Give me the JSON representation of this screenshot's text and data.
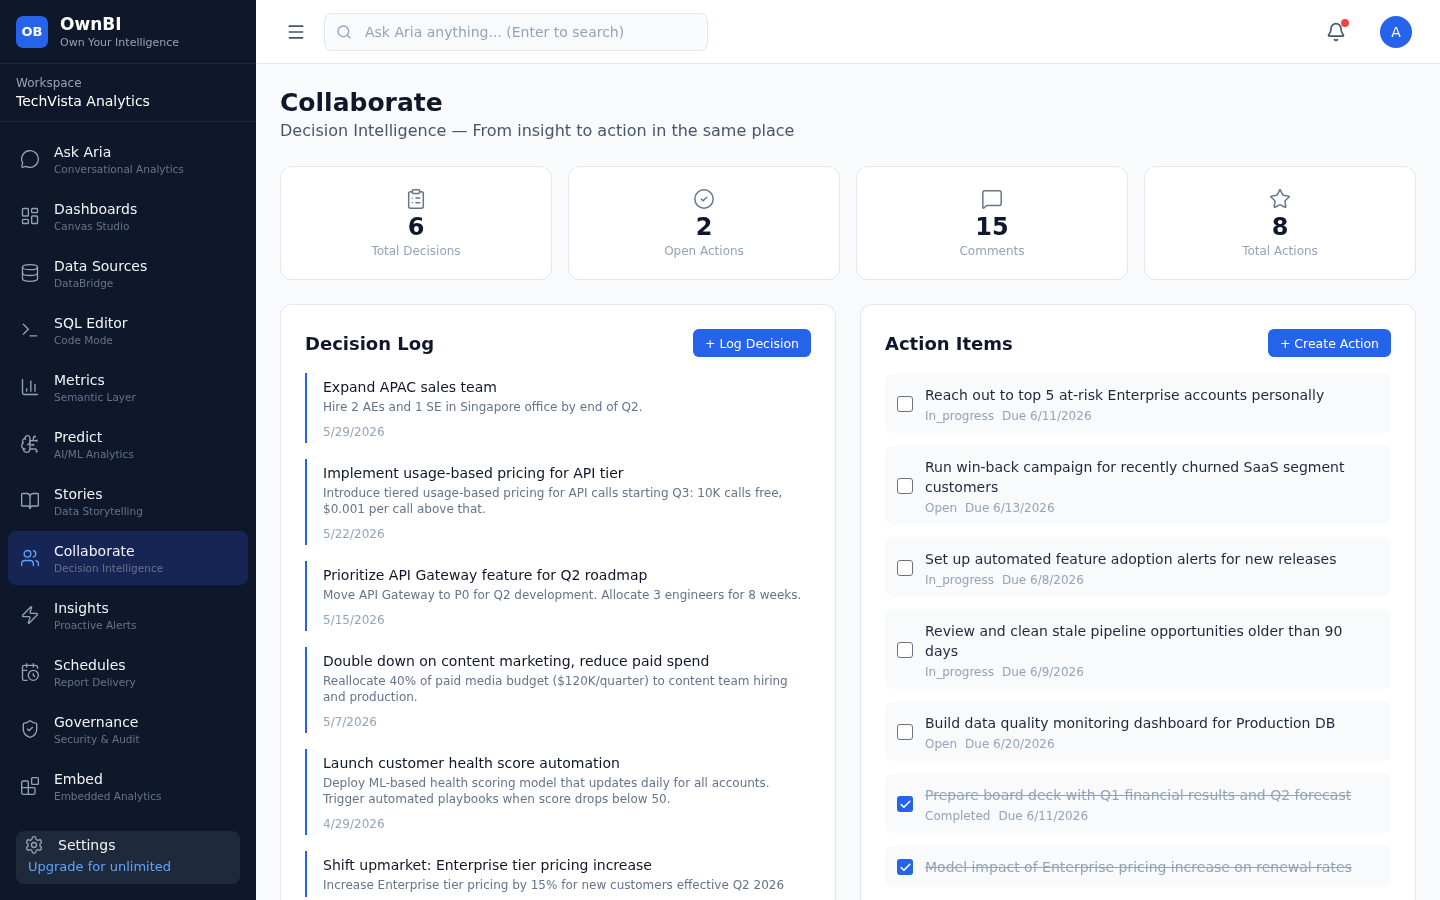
{
  "brand": {
    "logo": "OB",
    "name": "OwnBI",
    "tagline": "Own Your Intelligence"
  },
  "workspace": {
    "label": "Workspace",
    "name": "TechVista Analytics"
  },
  "sidebar": {
    "items": [
      {
        "label": "Ask Aria",
        "sub": "Conversational Analytics",
        "selected": false
      },
      {
        "label": "Dashboards",
        "sub": "Canvas Studio",
        "selected": false
      },
      {
        "label": "Data Sources",
        "sub": "DataBridge",
        "selected": false
      },
      {
        "label": "SQL Editor",
        "sub": "Code Mode",
        "selected": false
      },
      {
        "label": "Metrics",
        "sub": "Semantic Layer",
        "selected": false
      },
      {
        "label": "Predict",
        "sub": "AI/ML Analytics",
        "selected": false
      },
      {
        "label": "Stories",
        "sub": "Data Storytelling",
        "selected": false
      },
      {
        "label": "Collaborate",
        "sub": "Decision Intelligence",
        "selected": true
      },
      {
        "label": "Insights",
        "sub": "Proactive Alerts",
        "selected": false
      },
      {
        "label": "Schedules",
        "sub": "Report Delivery",
        "selected": false
      },
      {
        "label": "Governance",
        "sub": "Security & Audit",
        "selected": false
      },
      {
        "label": "Embed",
        "sub": "Embedded Analytics",
        "selected": false
      }
    ],
    "settings": {
      "label": "Settings"
    },
    "upgrade_link": "Upgrade for unlimited"
  },
  "header": {
    "search": {
      "placeholder": "Ask Aria anything... (Enter to search)"
    },
    "notifications_unread": true,
    "avatar": "A"
  },
  "page": {
    "title": "Collaborate",
    "subtitle": "Decision Intelligence — From insight to action in the same place"
  },
  "stats": [
    {
      "value": "6",
      "label": "Total Decisions"
    },
    {
      "value": "2",
      "label": "Open Actions"
    },
    {
      "value": "15",
      "label": "Comments"
    },
    {
      "value": "8",
      "label": "Total Actions"
    }
  ],
  "decision_log": {
    "title": "Decision Log",
    "button": "+ Log Decision",
    "items": [
      {
        "title": "Expand APAC sales team",
        "description": "Hire 2 AEs and 1 SE in Singapore office by end of Q2.",
        "date": "5/29/2026"
      },
      {
        "title": "Implement usage-based pricing for API tier",
        "description": "Introduce tiered usage-based pricing for API calls starting Q3: 10K calls free, $0.001 per call above that.",
        "date": "5/22/2026"
      },
      {
        "title": "Prioritize API Gateway feature for Q2 roadmap",
        "description": "Move API Gateway to P0 for Q2 development. Allocate 3 engineers for 8 weeks.",
        "date": "5/15/2026"
      },
      {
        "title": "Double down on content marketing, reduce paid spend",
        "description": "Reallocate 40% of paid media budget ($120K/quarter) to content team hiring and production.",
        "date": "5/7/2026"
      },
      {
        "title": "Launch customer health score automation",
        "description": "Deploy ML-based health scoring model that updates daily for all accounts. Trigger automated playbooks when score drops below 50.",
        "date": "4/29/2026"
      },
      {
        "title": "Shift upmarket: Enterprise tier pricing increase",
        "description": "Increase Enterprise tier pricing by 15% for new customers effective Q2 2026"
      }
    ]
  },
  "action_items": {
    "title": "Action Items",
    "button": "+ Create Action",
    "items": [
      {
        "title": "Reach out to top 5 at-risk Enterprise accounts personally",
        "status": "In_progress",
        "due": "Due 6/11/2026",
        "checked": false
      },
      {
        "title": "Run win-back campaign for recently churned SaaS segment customers",
        "status": "Open",
        "due": "Due 6/13/2026",
        "checked": false
      },
      {
        "title": "Set up automated feature adoption alerts for new releases",
        "status": "In_progress",
        "due": "Due 6/8/2026",
        "checked": false
      },
      {
        "title": "Review and clean stale pipeline opportunities older than 90 days",
        "status": "In_progress",
        "due": "Due 6/9/2026",
        "checked": false
      },
      {
        "title": "Build data quality monitoring dashboard for Production DB",
        "status": "Open",
        "due": "Due 6/20/2026",
        "checked": false
      },
      {
        "title": "Prepare board deck with Q1 financial results and Q2 forecast",
        "status": "Completed",
        "due": "Due 6/11/2026",
        "checked": true
      },
      {
        "title": "Model impact of Enterprise pricing increase on renewal rates",
        "checked": true
      }
    ]
  }
}
